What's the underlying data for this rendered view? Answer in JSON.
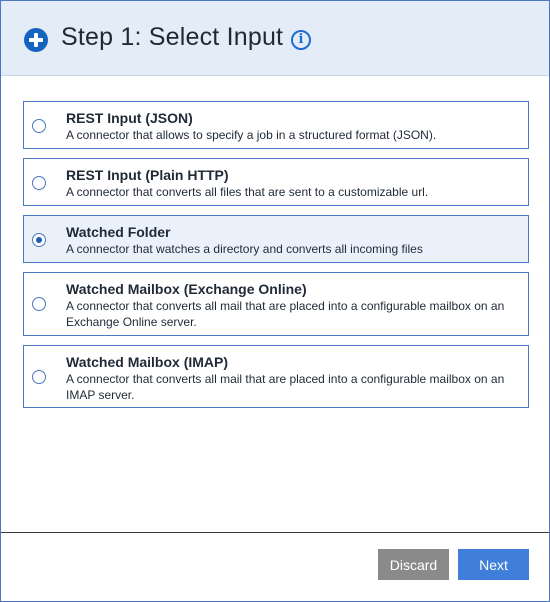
{
  "header": {
    "title": "Step 1: Select Input",
    "plus_icon": "plus-circle-icon",
    "info_icon": "info-icon",
    "info_glyph": "i"
  },
  "options": [
    {
      "title": "REST Input (JSON)",
      "description": "A connector that allows to specify a job in a structured format (JSON).",
      "selected": false
    },
    {
      "title": "REST Input (Plain HTTP)",
      "description": "A connector that converts all files that are sent to a customizable url.",
      "selected": false
    },
    {
      "title": "Watched Folder",
      "description": "A connector that watches a directory and converts all incoming files",
      "selected": true
    },
    {
      "title": "Watched Mailbox (Exchange Online)",
      "description": "A connector that converts all mail that are placed into a configurable mailbox on an Exchange Online server.",
      "selected": false
    },
    {
      "title": "Watched Mailbox (IMAP)",
      "description": "A connector that converts all mail that are placed into a configurable mailbox on an IMAP server.",
      "selected": false
    }
  ],
  "footer": {
    "discard_label": "Discard",
    "next_label": "Next"
  },
  "colors": {
    "header_bg": "#e3ecf7",
    "accent": "#1565c0",
    "border": "#4a78c2",
    "selected_bg": "#eaf1fb",
    "discard_bg": "#8a8a8a",
    "next_bg": "#3f7fd9"
  }
}
